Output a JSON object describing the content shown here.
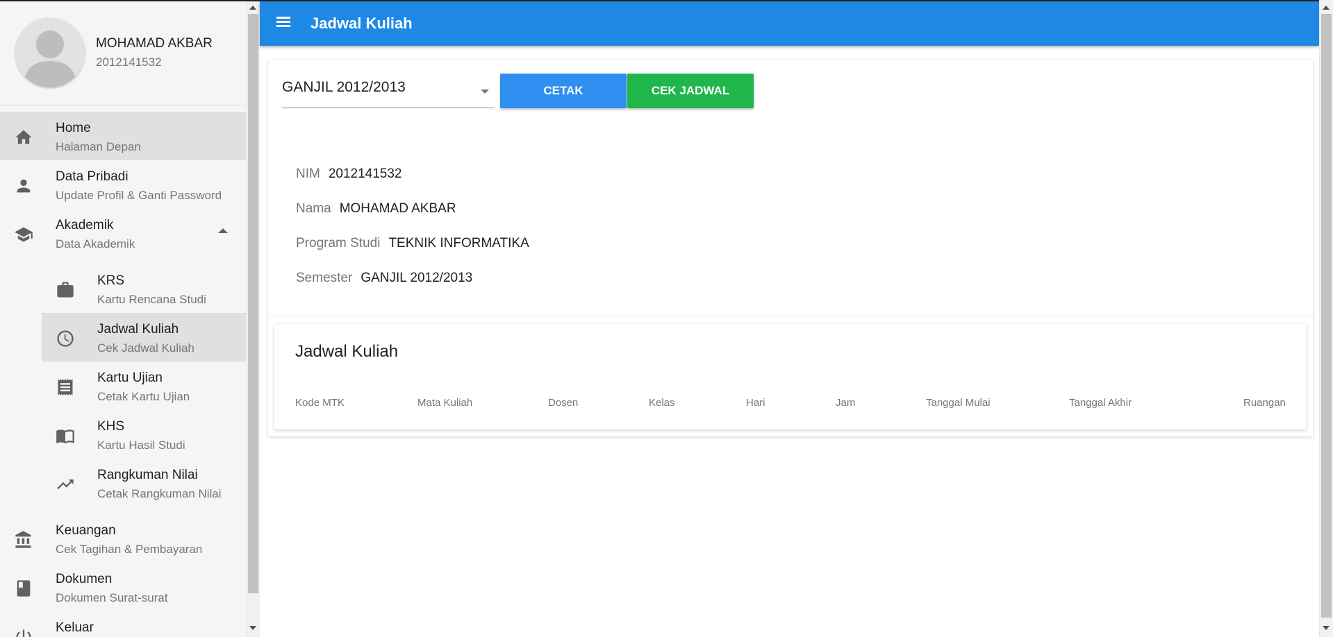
{
  "profile": {
    "name": "MOHAMAD AKBAR",
    "nim": "2012141532"
  },
  "sidebar": {
    "items": [
      {
        "title": "Home",
        "subtitle": "Halaman Depan",
        "icon": "home-icon",
        "active": true
      },
      {
        "title": "Data Pribadi",
        "subtitle": "Update Profil & Ganti Password",
        "icon": "person-icon"
      },
      {
        "title": "Akademik",
        "subtitle": "Data Akademik",
        "icon": "school-icon",
        "expanded": true
      },
      {
        "title": "KRS",
        "subtitle": "Kartu Rencana Studi",
        "icon": "briefcase-icon"
      },
      {
        "title": "Jadwal Kuliah",
        "subtitle": "Cek Jadwal Kuliah",
        "icon": "clock-icon",
        "active": true
      },
      {
        "title": "Kartu Ujian",
        "subtitle": "Cetak Kartu Ujian",
        "icon": "receipt-icon"
      },
      {
        "title": "KHS",
        "subtitle": "Kartu Hasil Studi",
        "icon": "book-open-icon"
      },
      {
        "title": "Rangkuman Nilai",
        "subtitle": "Cetak Rangkuman Nilai",
        "icon": "trending-up-icon"
      },
      {
        "title": "Keuangan",
        "subtitle": "Cek Tagihan & Pembayaran",
        "icon": "bank-icon"
      },
      {
        "title": "Dokumen",
        "subtitle": "Dokumen Surat-surat",
        "icon": "book-icon"
      },
      {
        "title": "Keluar",
        "subtitle": "",
        "icon": "power-icon"
      }
    ]
  },
  "appbar": {
    "title": "Jadwal Kuliah",
    "color": "#1e88e5"
  },
  "filter": {
    "semester_selected": "GANJIL 2012/2013",
    "cetak_label": "CETAK",
    "cek_label": "CEK JADWAL"
  },
  "info": {
    "nim_label": "NIM",
    "nim_value": "2012141532",
    "nama_label": "Nama",
    "nama_value": "MOHAMAD AKBAR",
    "prodi_label": "Program Studi",
    "prodi_value": "TEKNIK INFORMATIKA",
    "semester_label": "Semester",
    "semester_value": "GANJIL 2012/2013"
  },
  "schedule": {
    "title": "Jadwal Kuliah",
    "columns": [
      "Kode MTK",
      "Mata Kuliah",
      "Dosen",
      "Kelas",
      "Hari",
      "Jam",
      "Tanggal Mulai",
      "Tanggal Akhir",
      "Ruangan"
    ],
    "rows": []
  }
}
